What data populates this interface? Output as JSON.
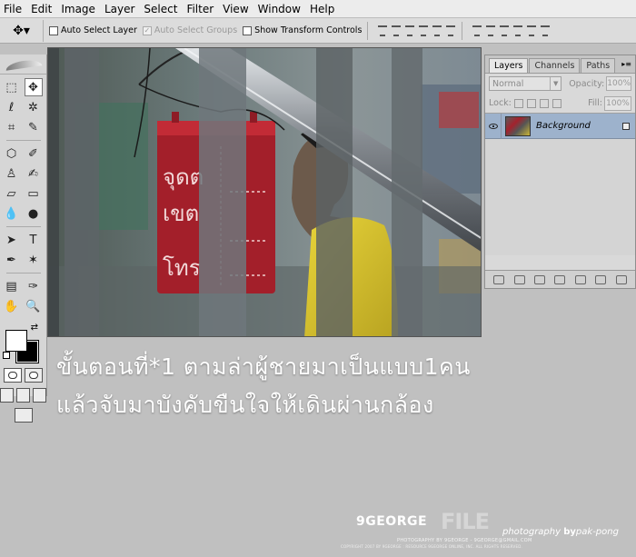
{
  "menu": [
    "File",
    "Edit",
    "Image",
    "Layer",
    "Select",
    "Filter",
    "View",
    "Window",
    "Help"
  ],
  "options": {
    "auto_select_layer": "Auto Select Layer",
    "auto_select_groups": "Auto Select Groups",
    "show_transform_controls": "Show Transform Controls"
  },
  "layers_panel": {
    "tabs": [
      "Layers",
      "Channels",
      "Paths"
    ],
    "blend_mode": "Normal",
    "opacity_label": "Opacity:",
    "opacity_value": "100%",
    "lock_label": "Lock:",
    "fill_label": "Fill:",
    "fill_value": "100%",
    "layer_name": "Background"
  },
  "caption": {
    "line1": "ขั้นตอนที่*1 ตามล่าผู้ชายมาเป็นแบบ1คน",
    "line2": "แล้วจับมาบังคับขืนใจให้เดินผ่านกล้อง"
  },
  "photo_signs": {
    "line1": "จุดต",
    "line2": "เขต",
    "line3": "โทร"
  },
  "watermark": {
    "brand": "9GEORGE",
    "file": "FILE",
    "photography_prefix": "photography",
    "photography_by": "by",
    "photographer": "pak-pong",
    "credit": "PHOTOGRAPHY BY 9GEORGE - 9GEORGE@GMAIL.COM",
    "copyright": "COPYRIGHT 2007 BY 9GEORGE : RESOURCE 9GEORGE ONLINE, INC. ALL RIGHTS RESERVED."
  }
}
